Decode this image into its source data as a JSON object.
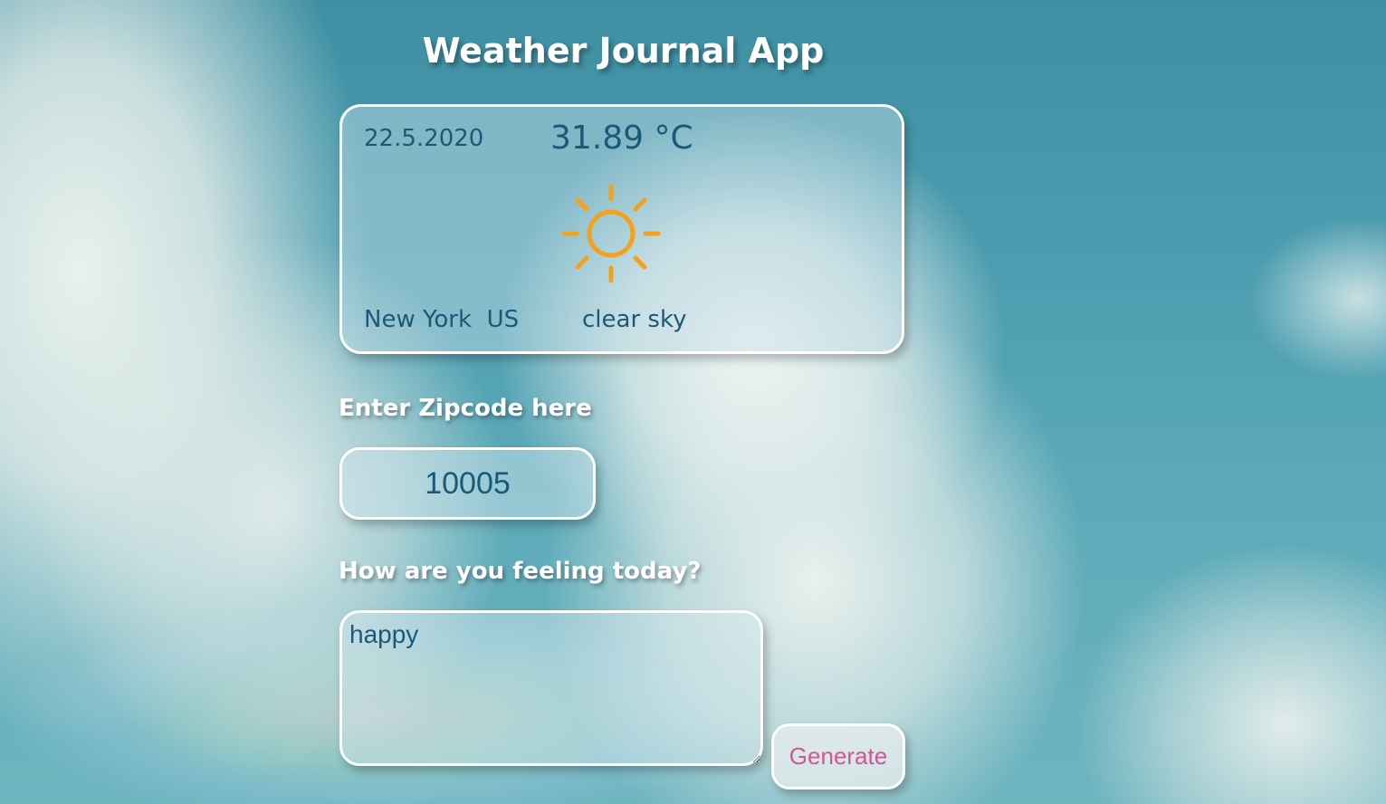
{
  "app": {
    "title": "Weather Journal App"
  },
  "weather_card": {
    "date": "22.5.2020",
    "temperature": "31.89 °C",
    "icon": "sun-icon",
    "icon_color": "#f2a21c",
    "location": "New York  US",
    "description": "clear sky"
  },
  "form": {
    "zip_label": "Enter Zipcode here",
    "zip_value": "10005",
    "feelings_label": "How are you feeling today?",
    "feelings_value": "happy",
    "generate_label": "Generate"
  },
  "colors": {
    "text_primary": "#1a5a78",
    "button_text": "#d0559a",
    "border": "#ffffff"
  }
}
